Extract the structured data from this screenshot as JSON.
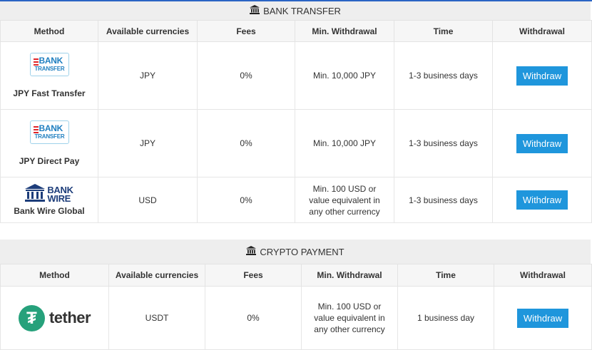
{
  "bank_section": {
    "title": "BANK TRANSFER",
    "headers": [
      "Method",
      "Available currencies",
      "Fees",
      "Min. Withdrawal",
      "Time",
      "Withdrawal"
    ],
    "rows": [
      {
        "logo_line1": "BANK",
        "logo_line2": "TRANSFER",
        "method": "JPY Fast Transfer",
        "currency": "JPY",
        "fees": "0%",
        "min": "Min. 10,000 JPY",
        "time": "1-3 business days",
        "button": "Withdraw"
      },
      {
        "logo_line1": "BANK",
        "logo_line2": "TRANSFER",
        "method": "JPY Direct Pay",
        "currency": "JPY",
        "fees": "0%",
        "min": "Min. 10,000 JPY",
        "time": "1-3 business days",
        "button": "Withdraw"
      },
      {
        "logo_line1": "BANK",
        "logo_line2": "WIRE",
        "method": "Bank Wire Global",
        "currency": "USD",
        "fees": "0%",
        "min": "Min. 100 USD or value equivalent in any other currency",
        "time": "1-3 business days",
        "button": "Withdraw"
      }
    ]
  },
  "crypto_section": {
    "title": "CRYPTO PAYMENT",
    "headers": [
      "Method",
      "Available currencies",
      "Fees",
      "Min. Withdrawal",
      "Time",
      "Withdrawal"
    ],
    "rows": [
      {
        "logo_symbol": "₮",
        "logo_text": "tether",
        "currency": "USDT",
        "fees": "0%",
        "min": "Min. 100 USD or value equivalent in any other currency",
        "time": "1 business day",
        "button": "Withdraw"
      }
    ]
  },
  "colors": {
    "accent": "#1f96dc",
    "section_bg": "#eeeeee",
    "tether": "#26a17b",
    "bank_red": "#e0262a",
    "bank_blue": "#1f7fc0",
    "wire_navy": "#1d3d7a"
  },
  "icons": {
    "section_icon": "bank-building-icon"
  }
}
